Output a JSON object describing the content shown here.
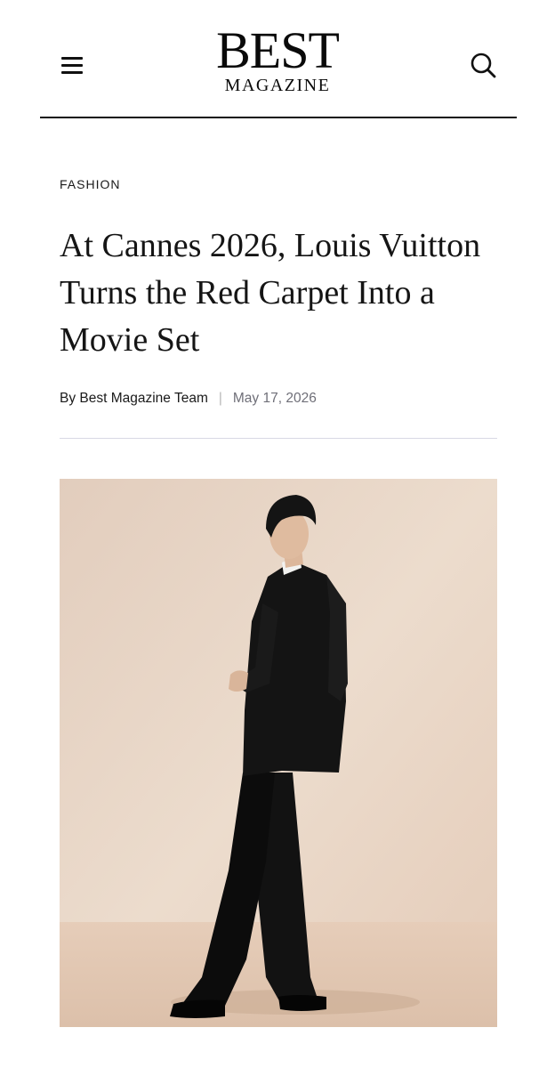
{
  "header": {
    "logo_main": "BEST",
    "logo_sub": "MAGAZINE",
    "menu_icon": "hamburger-menu-icon",
    "search_icon": "search-icon"
  },
  "article": {
    "category": "FASHION",
    "headline": "At Cannes 2026, Louis Vuitton Turns the Red Carpet Into a Movie Set",
    "author": "By Best Magazine Team",
    "separator": "|",
    "date": "May 17, 2026"
  },
  "hero_image": {
    "subject": "man-in-black-suit-photo",
    "background_color": "#e9d6c6",
    "suit_color": "#111111"
  }
}
